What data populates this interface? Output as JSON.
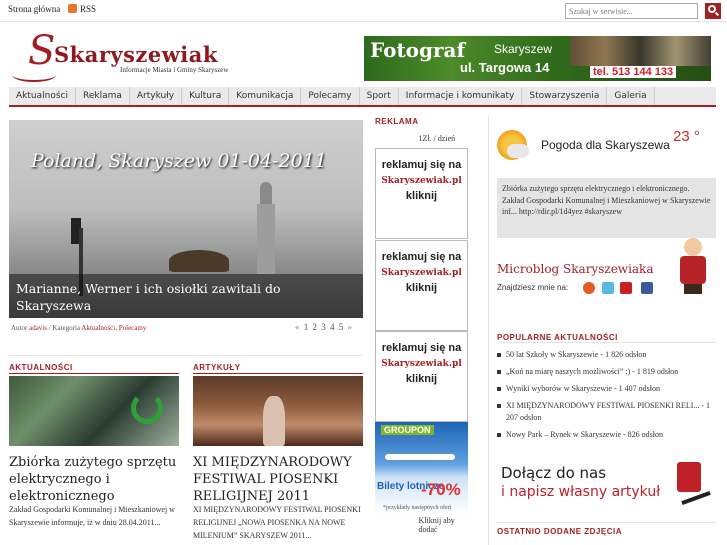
{
  "topbar": {
    "home_link": "Strona główna",
    "rss_link": "RSS",
    "search_placeholder": "Szukaj w serwisie..."
  },
  "logo": {
    "wordmark": "Skaryszewiak",
    "tagline": "Informacje Miasta i Gminy Skaryszew",
    "initial": "S"
  },
  "banner": {
    "line1": "Fotograf",
    "line2": "Skaryszew",
    "line3": "ul. Targowa 14",
    "phone": "tel. 513 144 133"
  },
  "nav": {
    "items": [
      {
        "label": "Aktualności"
      },
      {
        "label": "Reklama"
      },
      {
        "label": "Artykuły"
      },
      {
        "label": "Kultura"
      },
      {
        "label": "Komunikacja"
      },
      {
        "label": "Polecamy"
      },
      {
        "label": "Sport"
      },
      {
        "label": "Informacje i komunikaty"
      },
      {
        "label": "Stowarzyszenia"
      },
      {
        "label": "Galeria"
      }
    ]
  },
  "slider": {
    "stamp": "Poland, Skaryszew 01-04-2011",
    "caption": "Marianne, Werner i ich osiołki zawitali do Skaryszewa",
    "meta_author_prefix": "Autor",
    "meta_author": "adavis",
    "meta_category_prefix": "/ Kategoria",
    "meta_categories": "Aktualności, Polecamy",
    "pager_prev": "«",
    "pager_pages": "1 2 3 4 5",
    "pager_next": "»"
  },
  "news": {
    "section1": "AKTUALNOŚCI",
    "section2": "ARTYKUŁY",
    "article1_title": "Zbiórka zużytego sprzętu elektrycznego i elektronicznego",
    "article1_body": "Zakład Gospodarki Komunalnej i Mieszkaniowej w Skaryszewie informuje, iż w dniu 28.04.2011...",
    "article2_title": "XI MIĘDZYNARODOWY FESTIWAL PIOSENKI RELIGIJNEJ 2011",
    "article2_body": "XI MIĘDZYNARODOWY FESTIWAL PIOSENKI RELIGIJNEJ „NOWA PIOSENKA NA NOWE MILENIUM” SKARYSZEW 2011..."
  },
  "ads": {
    "label": "REKLAMA",
    "price": "1Zł. / dzień",
    "box_line1": "reklamuj się na",
    "box_brand": "Skaryszewiak.pl",
    "box_click": "kliknij",
    "groupon_brand": "GROUPON",
    "groupon_tickets": "Bilety lotnicze",
    "groupon_pct": "-70%",
    "groupon_note": "*przykłady następnych ofert",
    "click_to_add": "Kliknij aby dodać"
  },
  "sidebar": {
    "weather_title": "Pogoda dla Skaryszewa",
    "weather_temp": "23 °",
    "tweet": "Zbiórka zużytego sprzętu elektrycznego i elektronicznego. Zakład Gospodarki Komunalnej i Mieszkaniowej w Skaryszewie inf... http://rdir.pl/1d4yez #skaryszew",
    "microblog_title": "Microblog Skaryszewiaka",
    "find_me": "Znajdziesz mnie na:",
    "popular_label": "POPULARNE AKTUALNOŚCI",
    "popular": [
      {
        "text": "50 lat Szkoły w Skaryszewie - 1 826 odsłon"
      },
      {
        "text": "„Koń na miarę naszych możliwości” ;) - 1 819 odsłon"
      },
      {
        "text": "Wyniki wyborów w Skaryszewie - 1 407 odsłon"
      },
      {
        "text": "XI MIĘDZYNARODOWY FESTIWAL PIOSENKI RELI... - 1 207 odsłon"
      },
      {
        "text": "Nowy Park – Rynek w Skaryszewie - 826 odsłon"
      }
    ],
    "join_line1": "Dołącz do nas",
    "join_line2": "i napisz własny artykuł",
    "last_photos_label": "OSTATNIO DODANE ZDJĘCIA"
  },
  "colors": {
    "accent": "#a21f24",
    "nav_bg": "#eaeaea"
  }
}
